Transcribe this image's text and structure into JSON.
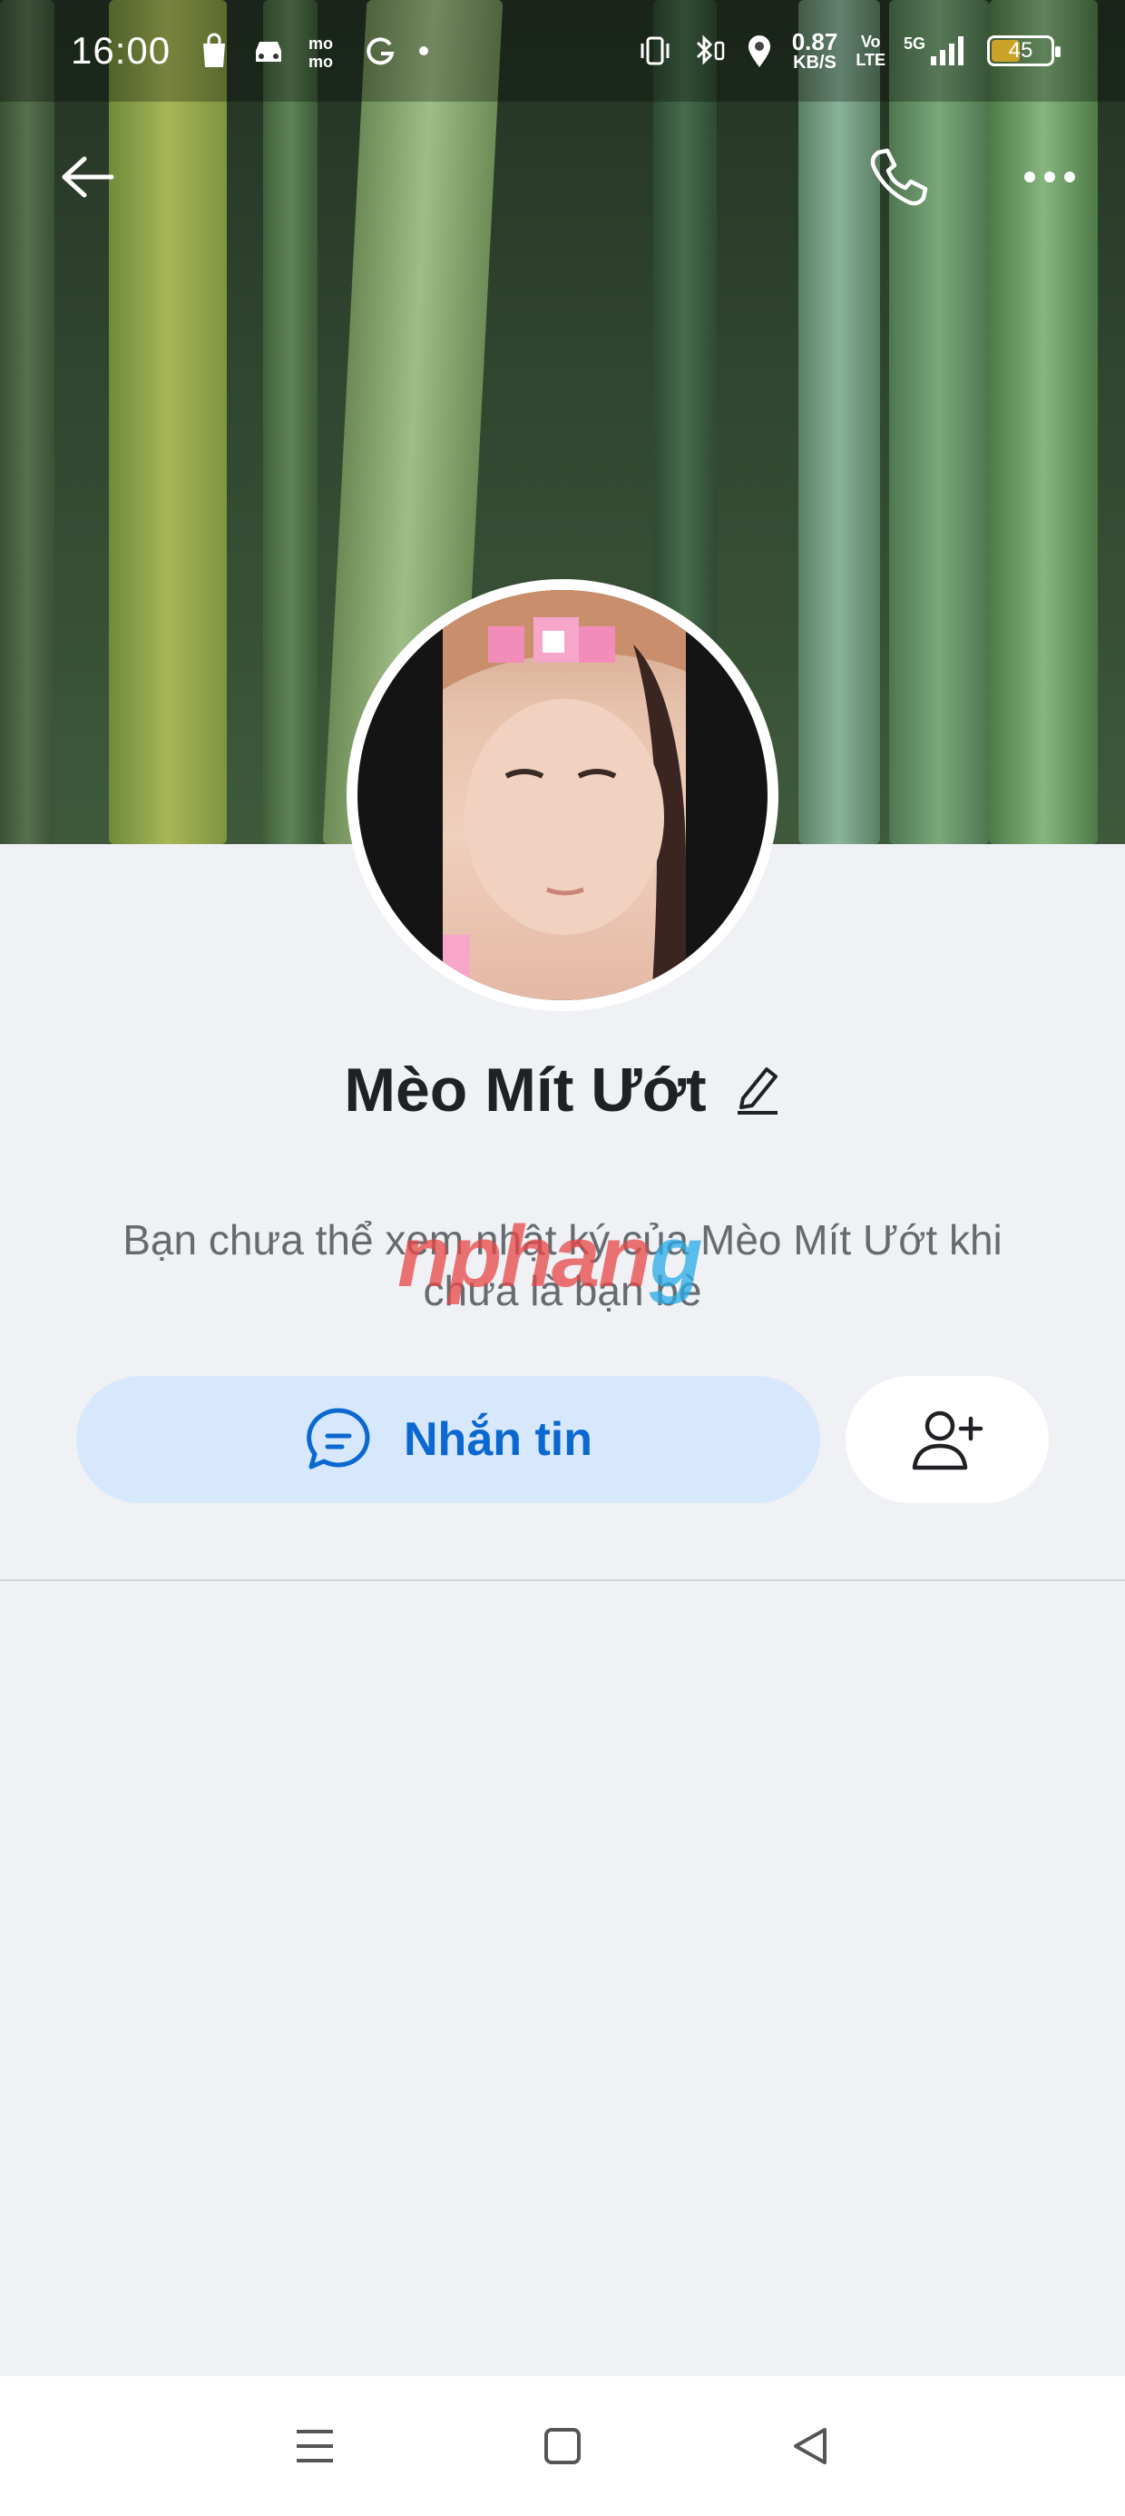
{
  "status_bar": {
    "time": "16:00",
    "speed_value": "0.87",
    "speed_unit": "KB/S",
    "volte_top": "Vo",
    "volte_bottom": "LTE",
    "network": "5G",
    "battery_level": "45"
  },
  "profile": {
    "name": "Mèo Mít Ướt",
    "diary_notice": "Bạn chưa thể xem nhật ký của Mèo Mít Ướt khi chưa là bạn bè"
  },
  "actions": {
    "message_label": "Nhắn tin"
  },
  "watermark": {
    "part1": "nphan",
    "part2": "g"
  },
  "colors": {
    "accent": "#0a68d0",
    "message_button_bg": "#d7e8fd",
    "page_bg": "#eff1f5"
  }
}
